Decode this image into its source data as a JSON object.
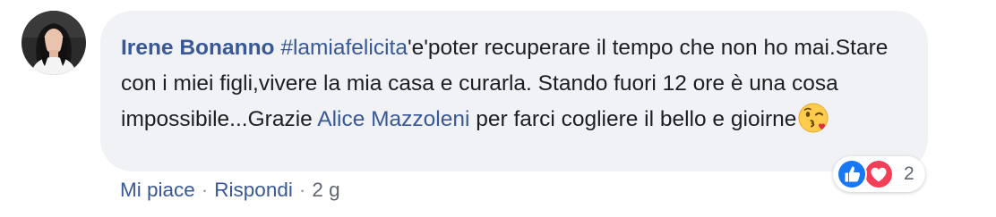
{
  "comment": {
    "author": "Irene Bonanno",
    "hashtag": "#lamiafelicita",
    "text_part1": "'e'poter recuperare il tempo che non ho mai.Stare con i miei figli,vivere la mia casa e curarla. Stando fuori 12 ore è una cosa impossibile...Grazie ",
    "mention": "Alice Mazzoleni",
    "text_part2": " per farci cogliere il bello e gioirne",
    "emoji": "face-throwing-kiss-icon"
  },
  "actions": {
    "like_label": "Mi piace",
    "reply_label": "Rispondi",
    "separator": "·",
    "timestamp": "2 g"
  },
  "reactions": {
    "icons": [
      "like-icon",
      "love-icon"
    ],
    "count": "2"
  },
  "colors": {
    "link_blue": "#385898",
    "bubble_bg": "#f0f2f5",
    "text": "#1c1e21",
    "like_blue": "#1877f2",
    "love_red": "#f33e58"
  }
}
